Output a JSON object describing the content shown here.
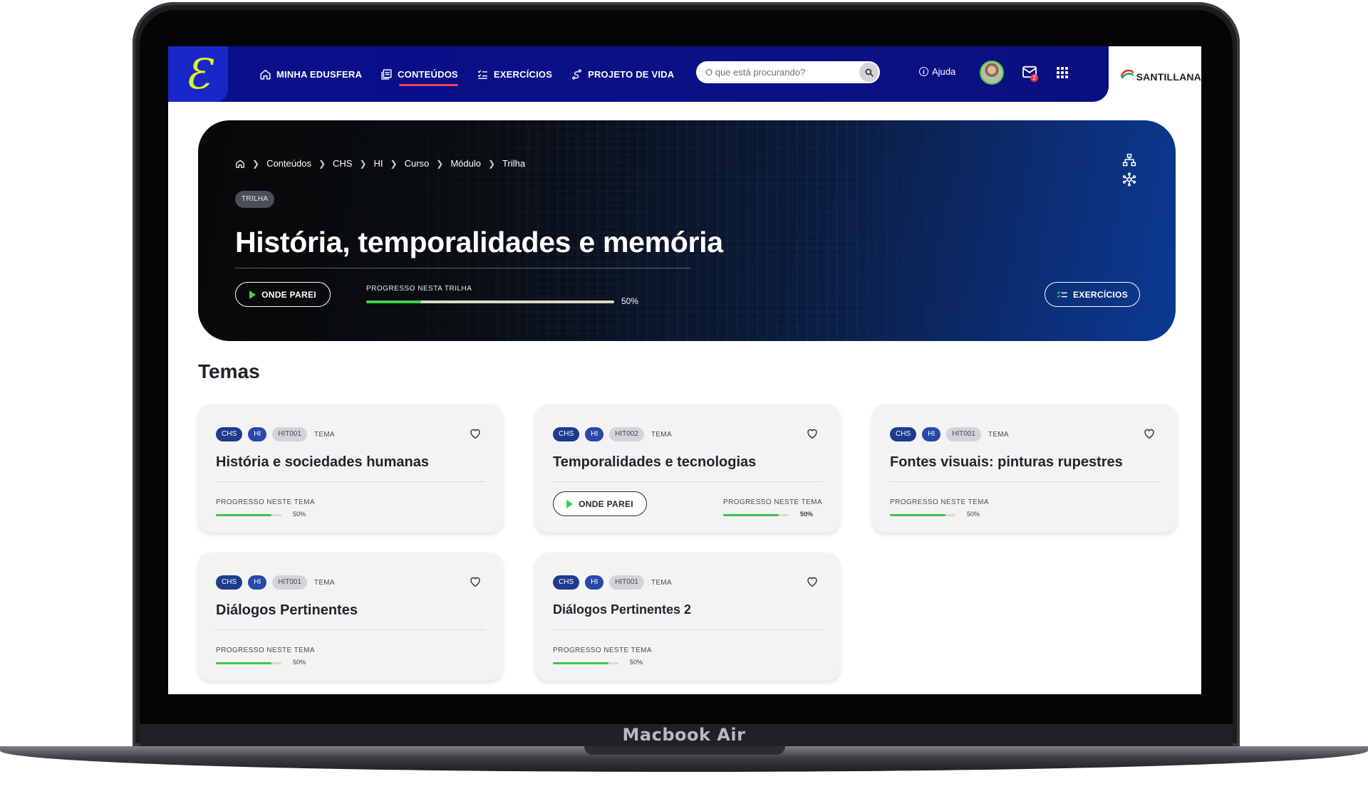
{
  "device": {
    "label": "Macbook Air"
  },
  "header": {
    "logo_glyph": "Ɛ",
    "nav": [
      {
        "label": "MINHA EDUSFERA",
        "icon": "home-icon",
        "active": false
      },
      {
        "label": "CONTEÚDOS",
        "icon": "book-icon",
        "active": true
      },
      {
        "label": "EXERCÍCIOS",
        "icon": "checklist-icon",
        "active": false
      },
      {
        "label": "PROJETO DE VIDA",
        "icon": "path-icon",
        "active": false
      }
    ],
    "search": {
      "placeholder": "O que está procurando?"
    },
    "help_label": "Ajuda",
    "mail_badge": "2",
    "brand": "SANTILLANA"
  },
  "hero": {
    "breadcrumb": [
      "Conteúdos",
      "CHS",
      "HI",
      "Curso",
      "Módulo",
      "Trilha"
    ],
    "badge": "TRILHA",
    "title": "História, temporalidades e memória",
    "resume_label": "ONDE PAREI",
    "progress_label": "PROGRESSO NESTA TRILHA",
    "progress_value": "50%",
    "progress_fraction": 0.22,
    "exercises_label": "EXERCÍCIOS"
  },
  "temas": {
    "title": "Temas",
    "cards": [
      {
        "tags": [
          "CHS",
          "HI",
          "HIT001"
        ],
        "kind": "TEMA",
        "title": "História e sociedades humanas",
        "progress_label": "PROGRESSO NESTE TEMA",
        "progress_value": "50%",
        "progress_fraction": 0.85,
        "resume": null
      },
      {
        "tags": [
          "CHS",
          "HI",
          "HIT002"
        ],
        "kind": "TEMA",
        "title": "Temporalidades e tecnologias",
        "progress_label": "PROGRESSO NESTE TEMA",
        "progress_value": "50%",
        "progress_fraction": 0.85,
        "resume": "ONDE PAREI"
      },
      {
        "tags": [
          "CHS",
          "HI",
          "HIT001"
        ],
        "kind": "TEMA",
        "title": "Fontes visuais: pinturas rupestres",
        "progress_label": "PROGRESSO NESTE TEMA",
        "progress_value": "50%",
        "progress_fraction": 0.85,
        "resume": null
      },
      {
        "tags": [
          "CHS",
          "HI",
          "HIT001"
        ],
        "kind": "TEMA",
        "title": "Diálogos Pertinentes",
        "progress_label": "PROGRESSO NESTE TEMA",
        "progress_value": "50%",
        "progress_fraction": 0.85,
        "resume": null
      },
      {
        "tags": [
          "CHS",
          "HI",
          "HIT001"
        ],
        "kind": "TEMA",
        "title": "Diálogos Pertinentes 2",
        "progress_label": "PROGRESSO NESTE TEMA",
        "progress_value": "50%",
        "progress_fraction": 0.85,
        "resume": null
      }
    ]
  },
  "colors": {
    "header_bg": "#0a0f8c",
    "accent_green": "#3ed04c",
    "active_underline": "#f0425d",
    "logo_lime": "#d9f227"
  }
}
